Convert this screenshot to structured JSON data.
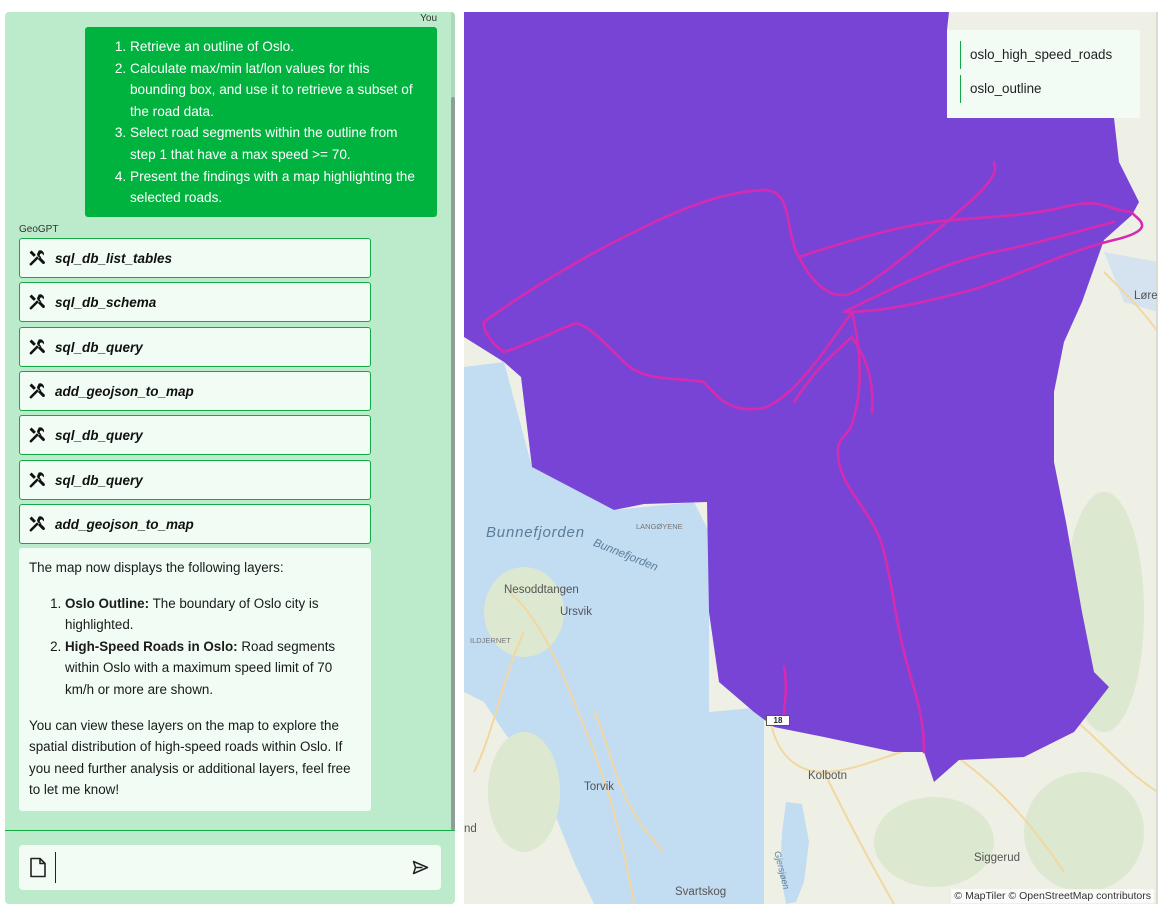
{
  "chat": {
    "user_label": "You",
    "user_request": [
      "Retrieve an outline of Oslo.",
      "Calculate max/min lat/lon values for this bounding box, and use it to retrieve a subset of the road data.",
      "Select road segments within the outline from step 1 that have a max speed >= 70.",
      "Present the findings with a map highlighting the selected roads."
    ],
    "assistant_label": "GeoGPT",
    "tool_calls": [
      {
        "name": "sql_db_list_tables",
        "icon": "tools-icon"
      },
      {
        "name": "sql_db_schema",
        "icon": "tools-icon"
      },
      {
        "name": "sql_db_query",
        "icon": "tools-icon"
      },
      {
        "name": "add_geojson_to_map",
        "icon": "tools-icon"
      },
      {
        "name": "sql_db_query",
        "icon": "tools-icon"
      },
      {
        "name": "sql_db_query",
        "icon": "tools-icon"
      },
      {
        "name": "add_geojson_to_map",
        "icon": "tools-icon"
      }
    ],
    "reply": {
      "intro": "The map now displays the following layers:",
      "items": [
        {
          "title": "Oslo Outline:",
          "text": "The boundary of Oslo city is highlighted."
        },
        {
          "title": "High-Speed Roads in Oslo:",
          "text": "Road segments within Oslo with a maximum speed limit of 70 km/h or more are shown."
        }
      ],
      "outro": "You can view these layers on the map to explore the spatial distribution of high-speed roads within Oslo. If you need further analysis or additional layers, feel free to let me know!"
    },
    "input": {
      "value": "",
      "placeholder": ""
    }
  },
  "map": {
    "legend": [
      "oslo_high_speed_roads",
      "oslo_outline"
    ],
    "attribution": "© MapTiler © OpenStreetMap contributors",
    "labels": {
      "bunnefjorden": "Bunnefjorden",
      "bunnefjorden_2": "Bunnefjorden",
      "langoyene": "LANGØYENE",
      "nesoddtangen": "Nesoddtangen",
      "ursvik": "Ursvik",
      "ildjernet": "ILDJERNET",
      "torvik": "Torvik",
      "kolbotn": "Kolbotn",
      "siggerud": "Siggerud",
      "svartskog": "Svartskog",
      "nd": "nd",
      "lore": "Løre",
      "gjersjoen": "Gjersjøen",
      "road_18": "18"
    },
    "colors": {
      "outline_fill": "#7844d6",
      "roads": "#d62bb0",
      "water": "#c2dcf2",
      "land": "#eef0e6"
    }
  },
  "colors": {
    "chat_bg": "#bcebcb",
    "user_bubble": "#00b33f",
    "card_border": "#14a844"
  }
}
